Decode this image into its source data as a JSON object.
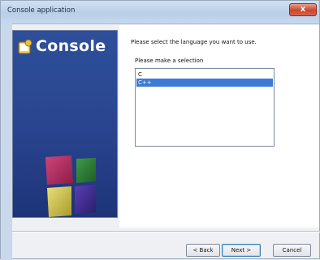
{
  "window": {
    "title": "Console application",
    "close_label": "x"
  },
  "banner": {
    "title": "Console"
  },
  "main": {
    "prompt": "Please select the language you want to use.",
    "group_label": "Please make a selection",
    "languages": [
      {
        "label": "C",
        "selected": false
      },
      {
        "label": "C++",
        "selected": true
      }
    ]
  },
  "buttons": {
    "back": "< Back",
    "next": "Next >",
    "cancel": "Cancel"
  },
  "colors": {
    "banner_blue": "#2e4f9a",
    "selection_blue": "#3d7ad6",
    "close_red": "#c9452e"
  }
}
